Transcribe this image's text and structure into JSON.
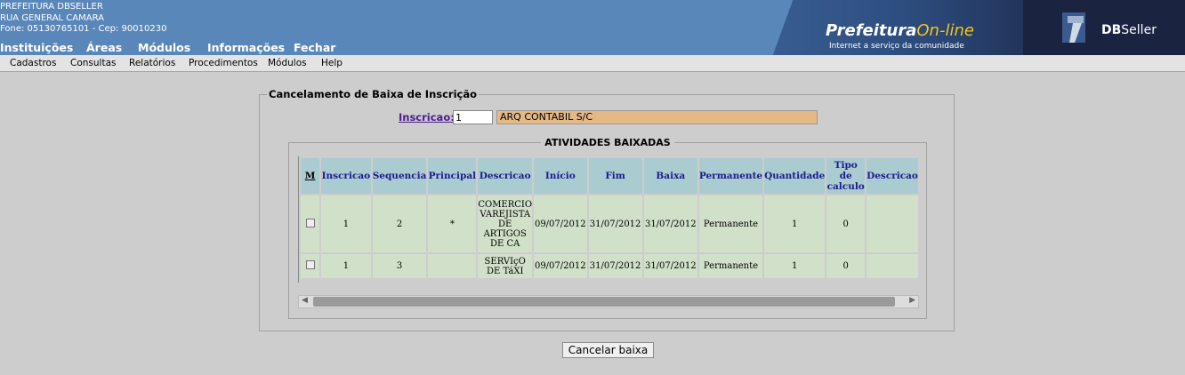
{
  "header": {
    "org_name": "PREFEITURA DBSELLER",
    "address": "RUA GENERAL CAMARA",
    "contact": "Fone: 05130765101  -  Cep: 90010230",
    "banner_title_main": "Prefeitura",
    "banner_title_accent": "On-line",
    "banner_subtitle": "Internet a serviço da comunidade",
    "logo_text_bold": "DB",
    "logo_text": "Seller"
  },
  "top_menu": [
    "Instituições",
    "Áreas",
    "Módulos",
    "Informações",
    "Fechar"
  ],
  "sub_menu": [
    "Cadastros",
    "Consultas",
    "Relatórios",
    "Procedimentos",
    "Módulos",
    "Help"
  ],
  "form": {
    "legend": "Cancelamento de Baixa de Inscrição",
    "inscricao_label": "Inscricao:",
    "inscricao_value": "1",
    "inscricao_name": "ARQ CONTABIL S/C",
    "grid_legend": "ATIVIDADES BAIXADAS",
    "columns": [
      "M",
      "Inscricao",
      "Sequencia",
      "Principal",
      "Descricao",
      "Início",
      "Fim",
      "Baixa",
      "Permanente",
      "Quantidade",
      "Tipo de calculo",
      "Descricao"
    ],
    "rows": [
      {
        "inscricao": "1",
        "sequencia": "2",
        "principal": "*",
        "descricao": "COMERCIO VAREJISTA DE ARTIGOS DE CA",
        "inicio": "09/07/2012",
        "fim": "31/07/2012",
        "baixa": "31/07/2012",
        "permanente": "Permanente",
        "quantidade": "1",
        "tipo": "0",
        "descricao2": ""
      },
      {
        "inscricao": "1",
        "sequencia": "3",
        "principal": "",
        "descricao": "SERVIçO DE TáXI",
        "inicio": "09/07/2012",
        "fim": "31/07/2012",
        "baixa": "31/07/2012",
        "permanente": "Permanente",
        "quantidade": "1",
        "tipo": "0",
        "descricao2": ""
      }
    ],
    "cancel_button": "Cancelar baixa"
  }
}
